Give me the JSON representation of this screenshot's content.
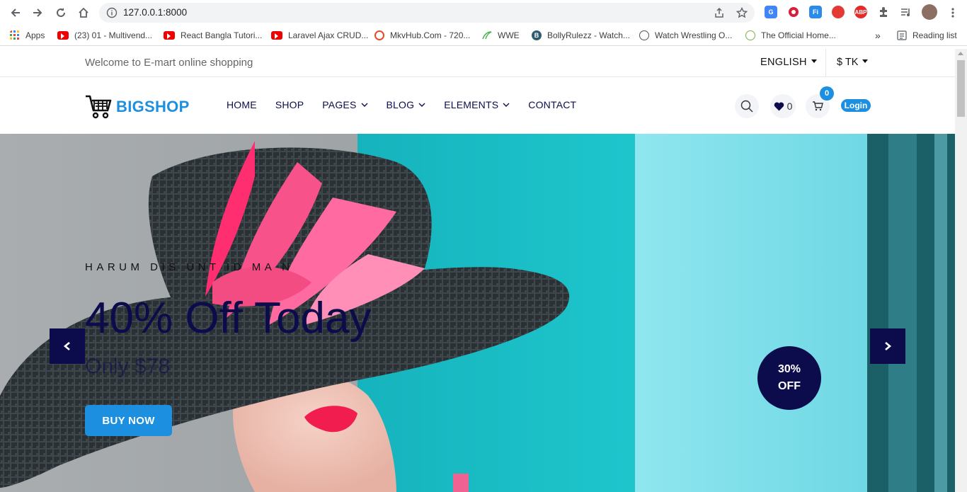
{
  "browser": {
    "url": "127.0.0.1:8000",
    "bookmarks": [
      {
        "label": "Apps",
        "icon": "apps-grid-icon"
      },
      {
        "label": "(23) 01 - Multivend...",
        "icon": "youtube-icon"
      },
      {
        "label": "React Bangla Tutori...",
        "icon": "youtube-icon"
      },
      {
        "label": "Laravel Ajax CRUD...",
        "icon": "youtube-icon"
      },
      {
        "label": "MkvHub.Com - 720...",
        "icon": "mkvhub-icon"
      },
      {
        "label": "WWE",
        "icon": "wwe-icon"
      },
      {
        "label": "BollyRulezz - Watch...",
        "icon": "bollyrulezz-icon"
      },
      {
        "label": "Watch Wrestling O...",
        "icon": "wordpress-icon"
      },
      {
        "label": "The Official Home...",
        "icon": "official-home-icon"
      }
    ],
    "overflow": "»",
    "reading_list": "Reading list"
  },
  "topbar": {
    "welcome": "Welcome to E-mart online shopping",
    "language": "ENGLISH",
    "currency": "$ TK"
  },
  "header": {
    "logo": "BIGSHOP",
    "menu": [
      "HOME",
      "SHOP",
      "PAGES",
      "BLOG",
      "ELEMENTS",
      "CONTACT"
    ],
    "wishlist_count": "0",
    "cart_count": "0",
    "login": "Login"
  },
  "hero": {
    "subtitle": "HARUM DIS   UNT ID MA N",
    "headline": "40% Off Today",
    "price": "Only $78",
    "button": "BUY NOW",
    "badge_line1": "30%",
    "badge_line2": "OFF"
  },
  "colors": {
    "brand": "#1d8fe1",
    "navy": "#0c0c4d"
  }
}
